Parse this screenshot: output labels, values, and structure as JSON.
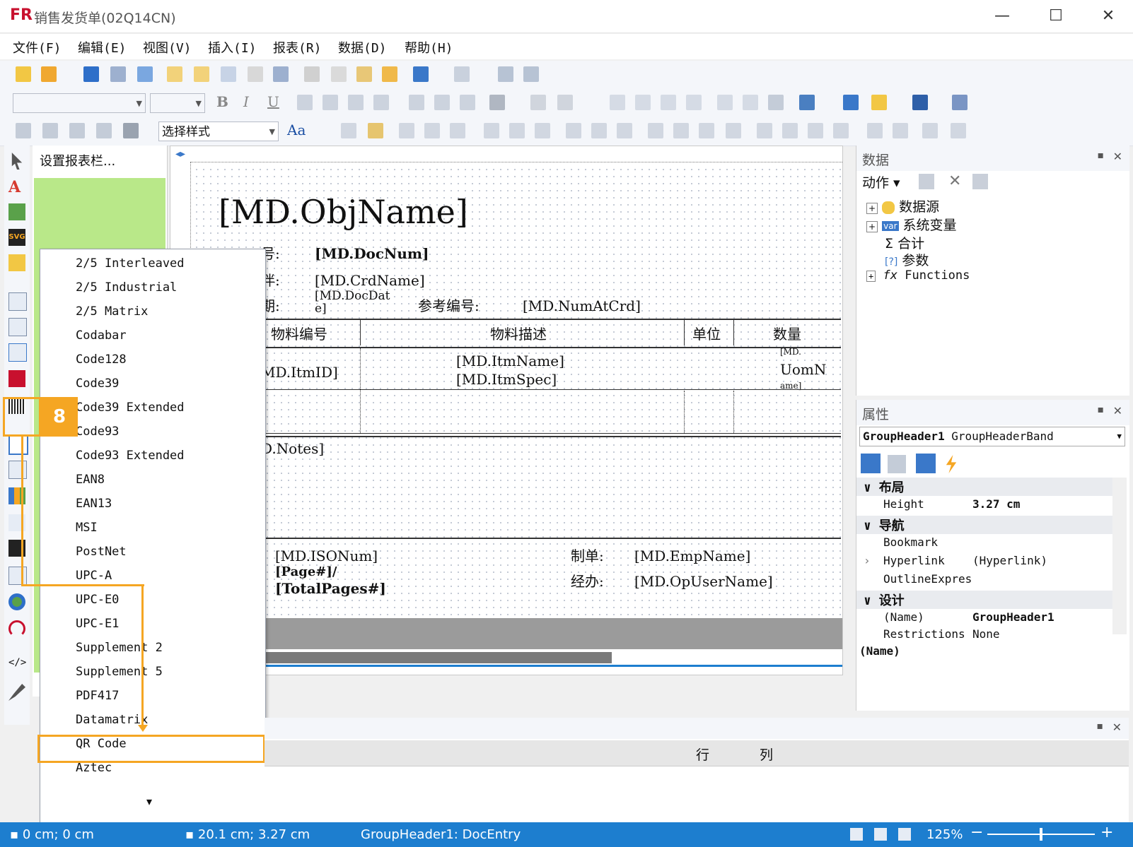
{
  "window": {
    "title": "销售发货单(02Q14CN)",
    "logo": "FR",
    "minimize": "—",
    "maximize": "☐",
    "close": "✕"
  },
  "menu": [
    "文件(F)",
    "编辑(E)",
    "视图(V)",
    "插入(I)",
    "报表(R)",
    "数据(D)",
    "帮助(H)"
  ],
  "toolbar3": {
    "style_combo": "选择样式",
    "font_btn": "Aa"
  },
  "left_panel": {
    "header": "设置报表栏..."
  },
  "callout": {
    "step": "8"
  },
  "canvas": {
    "title_field": "[MD.ObjName]",
    "labels": {
      "doc_label": "号:",
      "partner_label": "伴:",
      "date_label": "期:",
      "ref_label": "参考编号:",
      "maker_label": "制单:",
      "handler_label": "经办:"
    },
    "fields": {
      "docnum": "[MD.DocNum]",
      "crdname": "[MD.CrdName]",
      "docdate1": "[MD.DocDat",
      "docdate2": "e]",
      "numatcrd": "[MD.NumAtCrd]",
      "itmid": "MD.ItmID]",
      "itmname": "[MD.ItmName]",
      "itmspec": "[MD.ItmSpec]",
      "uom1": "[MD.",
      "uom2": "UomN",
      "uom3": "ame]",
      "notes": "D.Notes]",
      "isonum": "[MD.ISONum]",
      "page": "[Page#]/",
      "totalpages": "[TotalPages#]",
      "empname": "[MD.EmpName]",
      "opuser": "[MD.OpUserName]"
    },
    "columns": [
      "物料编号",
      "物料描述",
      "单位",
      "数量"
    ]
  },
  "barcode_menu": {
    "items": [
      "2/5 Interleaved",
      "2/5 Industrial",
      "2/5 Matrix",
      "Codabar",
      "Code128",
      "Code39",
      "Code39 Extended",
      "Code93",
      "Code93 Extended",
      "EAN8",
      "EAN13",
      "MSI",
      "PostNet",
      "UPC-A",
      "UPC-E0",
      "UPC-E1",
      "Supplement 2",
      "Supplement 5",
      "PDF417",
      "Datamatrix",
      "QR Code",
      "Aztec"
    ],
    "highlighted": "QR Code",
    "more_arrow": "▾"
  },
  "data_panel": {
    "title": "数据",
    "action": "动作",
    "tree": [
      {
        "label": "数据源",
        "icon": "database-icon"
      },
      {
        "label": "系统变量",
        "icon": "variable-icon",
        "badge": "var"
      },
      {
        "label": "合计",
        "icon": "sigma-icon",
        "glyph": "Σ"
      },
      {
        "label": "参数",
        "icon": "parameter-icon",
        "glyph": "[?]"
      },
      {
        "label": "Functions",
        "icon": "function-icon",
        "glyph": "fx"
      }
    ]
  },
  "props_panel": {
    "title": "属性",
    "selector_name": "GroupHeader1",
    "selector_type": "GroupHeaderBand",
    "sections": {
      "layout": "布局",
      "nav": "导航",
      "design": "设计"
    },
    "rows": {
      "height_key": "Height",
      "height_val": "3.27 cm",
      "bookmark_key": "Bookmark",
      "bookmark_val": "",
      "hyperlink_key": "Hyperlink",
      "hyperlink_val": "(Hyperlink)",
      "outline_key": "OutlineExpres",
      "outline_val": "",
      "name_key": "(Name)",
      "name_val": "GroupHeader1",
      "restr_key": "Restrictions",
      "restr_val": "None"
    },
    "desc": "(Name)"
  },
  "bottom_panel": {
    "col_row": "行",
    "col_col": "列"
  },
  "status": {
    "pos": "0 cm; 0 cm",
    "size": "20.1 cm; 3.27 cm",
    "band": "GroupHeader1:  DocEntry",
    "zoom": "125%",
    "minus": "−",
    "plus": "+"
  },
  "colors": {
    "accent_orange": "#f5a623",
    "status_blue": "#1d7ecf",
    "tree_green": "#b9e889"
  }
}
